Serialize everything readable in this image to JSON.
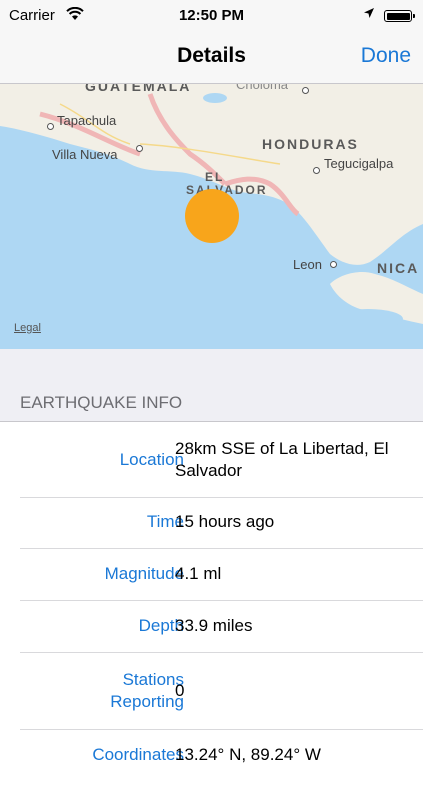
{
  "status_bar": {
    "carrier": "Carrier",
    "time": "12:50 PM",
    "icons": [
      "wifi-icon",
      "location-arrow-icon",
      "battery-icon"
    ]
  },
  "nav": {
    "title": "Details",
    "done_label": "Done"
  },
  "map": {
    "countries": [
      "GUATEMALA",
      "HONDURAS",
      "EL",
      "SALVADOR",
      "NICA"
    ],
    "cities": [
      "Tapachula",
      "Villa Nueva",
      "Tegucigalpa",
      "Leon",
      "Choloma"
    ],
    "legal_label": "Legal",
    "colors": {
      "water": "#aed7f3",
      "land": "#f2efe6",
      "marker": "#f8a51b"
    }
  },
  "section": {
    "title": "EARTHQUAKE INFO"
  },
  "details": [
    {
      "label": "Location",
      "value": "28km SSE of La Libertad, El Salvador"
    },
    {
      "label": "Time",
      "value": "15 hours ago"
    },
    {
      "label": "Magnitude",
      "value": "4.1 ml"
    },
    {
      "label": "Depth",
      "value": "33.9 miles"
    },
    {
      "label": "Stations Reporting",
      "value": "0"
    },
    {
      "label": "Coordinates",
      "value": "13.24° N, 89.24° W"
    }
  ]
}
